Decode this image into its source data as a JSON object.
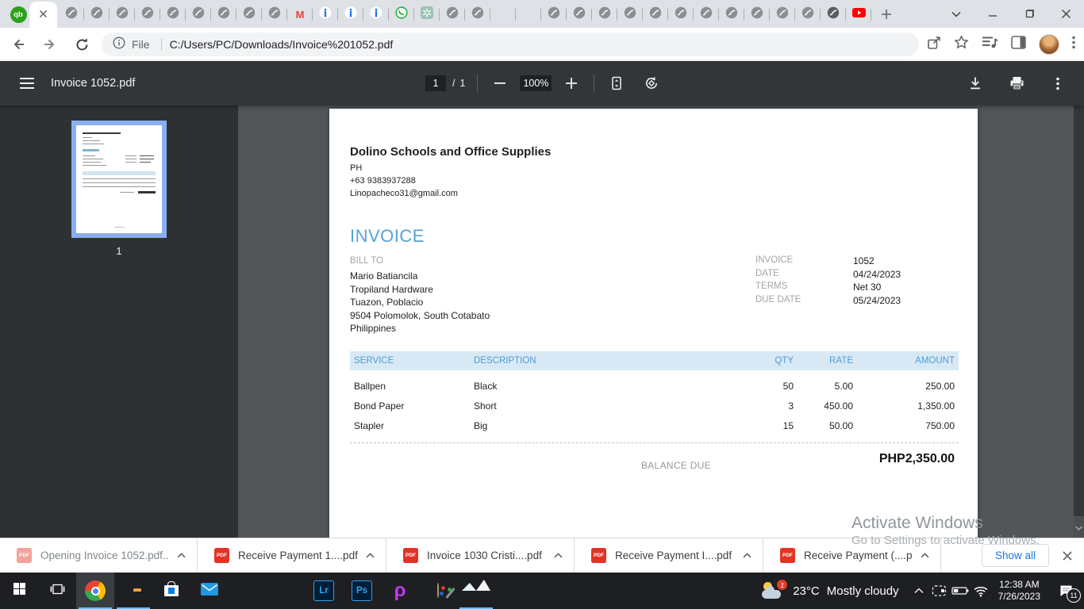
{
  "browser": {
    "pinned_tab": {
      "icon": "quickbooks-icon",
      "glyph": "qb"
    },
    "gmail_glyph": "M",
    "inactive_tab_icons": [
      "gray-circle",
      "gray-circle",
      "gray-circle",
      "gray-circle",
      "gray-circle",
      "gray-circle",
      "gray-circle",
      "gray-circle",
      "gray-circle",
      "gmail",
      "info-blue",
      "info-blue",
      "info-blue",
      "whatsapp",
      "chatgpt",
      "gray-circle",
      "gray-circle",
      "google-drive",
      "google-drive",
      "gray-circle",
      "gray-circle",
      "gray-circle",
      "gray-circle",
      "gray-circle",
      "gray-circle",
      "gray-circle",
      "gray-circle",
      "gray-circle",
      "gray-circle",
      "gray-circle",
      "chrome-gray",
      "youtube"
    ],
    "address_bar": {
      "scheme_label": "File",
      "url": "C:/Users/PC/Downloads/Invoice%201052.pdf"
    }
  },
  "pdf_viewer": {
    "title": "Invoice 1052.pdf",
    "page": {
      "current": "1",
      "separator": "/",
      "total": "1"
    },
    "zoom": "100%",
    "thumbnail_label": "1"
  },
  "invoice": {
    "company": {
      "name": "Dolino Schools and Office Supplies",
      "country": "PH",
      "phone": "+63 9383937288",
      "email": "Linopacheco31@gmail.com"
    },
    "doc_title": "INVOICE",
    "bill_to": {
      "label": "BILL TO",
      "lines": [
        "Mario Batiancila",
        "Tropiland Hardware",
        "Tuazon, Poblacio",
        "9504 Polomolok, South Cotabato",
        "Philippines"
      ]
    },
    "meta": [
      {
        "label": "INVOICE",
        "value": "1052"
      },
      {
        "label": "DATE",
        "value": "04/24/2023"
      },
      {
        "label": "TERMS",
        "value": "Net 30"
      },
      {
        "label": "DUE DATE",
        "value": "05/24/2023"
      }
    ],
    "table": {
      "headers": [
        "SERVICE",
        "DESCRIPTION",
        "QTY",
        "RATE",
        "AMOUNT"
      ],
      "rows": [
        [
          "Ballpen",
          "Black",
          "50",
          "5.00",
          "250.00"
        ],
        [
          "Bond Paper",
          "Short",
          "3",
          "450.00",
          "1,350.00"
        ],
        [
          "Stapler",
          "Big",
          "15",
          "50.00",
          "750.00"
        ]
      ]
    },
    "balance": {
      "label": "BALANCE DUE",
      "value": "PHP2,350.00"
    }
  },
  "watermark": {
    "line1": "Activate Windows",
    "line2": "Go to Settings to activate Windows."
  },
  "downloads_bar": {
    "items": [
      {
        "label": "Opening Invoice 1052.pdf...",
        "state": "opening"
      },
      {
        "label": "Receive Payment 1....pdf",
        "state": "done"
      },
      {
        "label": "Invoice 1030 Cristi....pdf",
        "state": "done"
      },
      {
        "label": "Receive Payment I....pdf",
        "state": "done"
      },
      {
        "label": "Receive Payment (....pdf",
        "state": "done"
      }
    ],
    "pdf_icon_label": "PDF",
    "show_all_label": "Show all"
  },
  "taskbar": {
    "apps": [
      {
        "id": "start"
      },
      {
        "id": "task-view"
      },
      {
        "id": "chrome",
        "active": true,
        "open": true
      },
      {
        "id": "file-explorer",
        "open": true
      },
      {
        "id": "microsoft-store"
      },
      {
        "id": "mail"
      },
      {
        "id": "firefox"
      },
      {
        "id": "edge"
      },
      {
        "id": "lightroom",
        "glyph": "Lr"
      },
      {
        "id": "photoshop",
        "glyph": "Ps"
      },
      {
        "id": "picsart",
        "glyph": "ρ"
      },
      {
        "id": "paint"
      },
      {
        "id": "photos",
        "open": true
      }
    ],
    "weather": {
      "badge": "1",
      "temp": "23°C",
      "condition": "Mostly cloudy"
    },
    "clock": {
      "time": "12:38 AM",
      "date": "7/26/2023"
    },
    "notifications": {
      "count": "11"
    }
  }
}
